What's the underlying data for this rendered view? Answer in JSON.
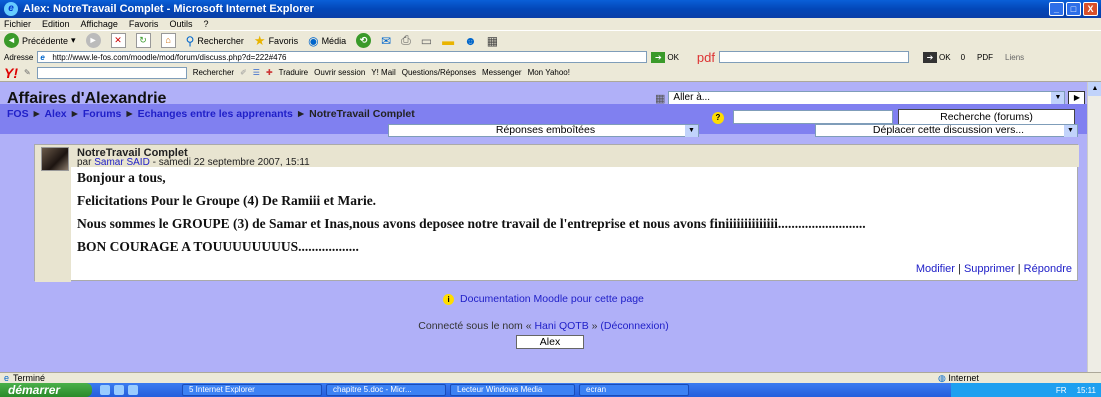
{
  "window": {
    "title": "Alex: NotreTravail Complet - Microsoft Internet Explorer",
    "minimize": "_",
    "maximize": "□",
    "close": "X"
  },
  "menu": [
    "Fichier",
    "Edition",
    "Affichage",
    "Favoris",
    "Outils",
    "?"
  ],
  "toolbar": {
    "back": "Précédente",
    "search": "Rechercher",
    "favorites": "Favoris",
    "media": "Média"
  },
  "address": {
    "label": "Adresse",
    "url": "http://www.le-fos.com/moodle/mod/forum/discuss.php?d=222#476",
    "ok": "OK",
    "pdf": "pdf",
    "ok2": "OK",
    "count": "0",
    "pdf_label": "PDF",
    "links": "Liens"
  },
  "yahoo": {
    "search": "Rechercher",
    "translate": "Traduire",
    "open_session": "Ouvrir session",
    "mail": "Y! Mail",
    "qa": "Questions/Réponses",
    "messenger": "Messenger",
    "my_yahoo": "Mon Yahoo!"
  },
  "site": {
    "title": "Affaires d'Alexandrie",
    "jump_placeholder": "Aller à..."
  },
  "breadcrumb": {
    "items": [
      "FOS",
      "Alex",
      "Forums",
      "Echanges entre les apprenants"
    ],
    "current": "NotreTravail Complet",
    "separator": "►"
  },
  "search": {
    "button": "Recherche (forums)"
  },
  "display_mode": "Réponses emboîtées",
  "move_discussion": "Déplacer cette discussion vers...",
  "post": {
    "subject": "NotreTravail Complet",
    "by": "par",
    "author": "Samar SAID",
    "date": "- samedi 22 septembre 2007, 15:11",
    "lines": [
      "Bonjour a tous,",
      "Felicitations Pour le Groupe (4) De Ramiii et Marie.",
      "Nous sommes  le GROUPE (3) de Samar et Inas,nous avons deposee notre travail de l'entreprise et nous avons finiiiiiiiiiiiiii..........................",
      "BON COURAGE A TOUUUUUUUUS.................."
    ],
    "action_edit": "Modifier",
    "action_delete": "Supprimer",
    "action_reply": "Répondre",
    "sep": "|"
  },
  "footer": {
    "doc_link": "Documentation Moodle pour cette page",
    "login_prefix": "Connecté sous le nom «",
    "user": "Hani QOTB",
    "login_suffix": "»",
    "logout": "(Déconnexion)",
    "home_button": "Alex"
  },
  "status": {
    "left": "Terminé",
    "zone": "Internet"
  },
  "taskbar": {
    "start": "démarrer",
    "tasks": [
      "5 Internet Explorer",
      "chapitre 5.doc - Micr...",
      "Lecteur Windows Media",
      "ecran"
    ],
    "lang": "FR",
    "time": "15:11"
  }
}
